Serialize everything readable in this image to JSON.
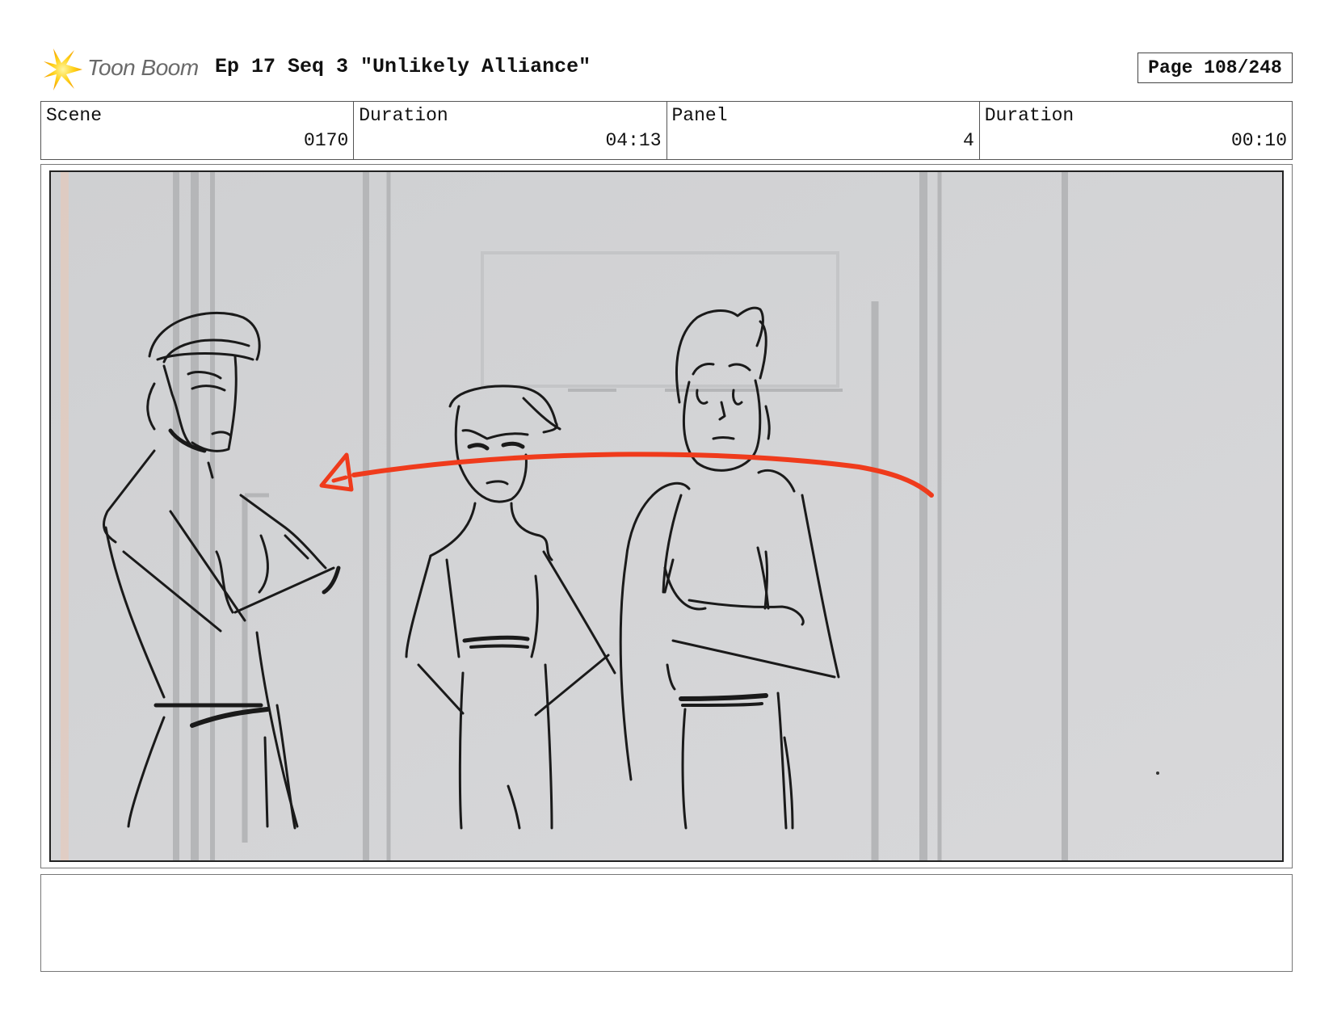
{
  "header": {
    "logo_text": "Toon Boom",
    "title": "Ep 17 Seq 3 \"Unlikely Alliance\"",
    "page": "Page 108/248"
  },
  "info": [
    {
      "label": "Scene",
      "value": "0170"
    },
    {
      "label": "Duration",
      "value": "04:13"
    },
    {
      "label": "Panel",
      "value": "4"
    },
    {
      "label": "Duration",
      "value": "00:10"
    }
  ],
  "panel": {
    "content": "storyboard sketch",
    "arrow_color": "#ef3b1c",
    "line_color": "#1a1a1a"
  },
  "notes": {
    "text": ""
  }
}
